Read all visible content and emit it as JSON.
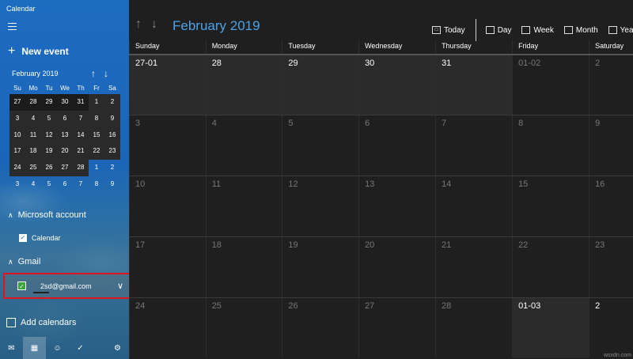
{
  "app": {
    "title": "Calendar"
  },
  "sidebar": {
    "new_event": "New event",
    "mini_calendar": {
      "header": "February 2019",
      "dow": [
        "Su",
        "Mo",
        "Tu",
        "We",
        "Th",
        "Fr",
        "Sa"
      ],
      "weeks": [
        [
          "27",
          "28",
          "29",
          "30",
          "31",
          "1",
          "2"
        ],
        [
          "3",
          "4",
          "5",
          "6",
          "7",
          "8",
          "9"
        ],
        [
          "10",
          "11",
          "12",
          "13",
          "14",
          "15",
          "16"
        ],
        [
          "17",
          "18",
          "19",
          "20",
          "21",
          "22",
          "23"
        ],
        [
          "24",
          "25",
          "26",
          "27",
          "28",
          "1",
          "2"
        ],
        [
          "3",
          "4",
          "5",
          "6",
          "7",
          "8",
          "9"
        ]
      ]
    },
    "accounts": [
      {
        "name": "Microsoft account",
        "calendar": "Calendar"
      },
      {
        "name": "Gmail",
        "calendar": "2sd@gmail.com"
      }
    ],
    "add_calendars": "Add calendars"
  },
  "main": {
    "month_title": "February 2019",
    "toolbar": {
      "today": "Today",
      "day": "Day",
      "week": "Week",
      "month": "Month",
      "year": "Year"
    },
    "dow": [
      "Sunday",
      "Monday",
      "Tuesday",
      "Wednesday",
      "Thursday",
      "Friday",
      "Saturday"
    ],
    "weeks": [
      [
        "27-01",
        "28",
        "29",
        "30",
        "31",
        "01-02",
        "2"
      ],
      [
        "3",
        "4",
        "5",
        "6",
        "7",
        "8",
        "9"
      ],
      [
        "10",
        "11",
        "12",
        "13",
        "14",
        "15",
        "16"
      ],
      [
        "17",
        "18",
        "19",
        "20",
        "21",
        "22",
        "23"
      ],
      [
        "24",
        "25",
        "26",
        "27",
        "28",
        "01-03",
        "2"
      ]
    ]
  },
  "watermark": "wsxdn.com",
  "colors": {
    "accent": "#4aa3e8",
    "sidebar": "#1c6cc2",
    "highlight_border": "#e0141e",
    "check_green": "#3ba339"
  }
}
